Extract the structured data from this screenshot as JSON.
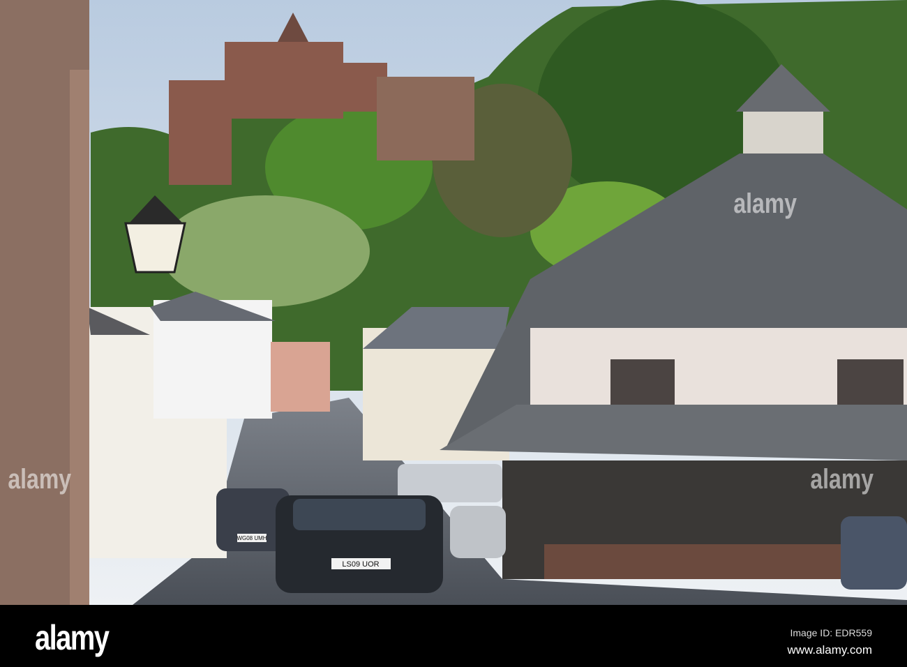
{
  "photo": {
    "subject": "village-street-with-castle-and-yarn-market"
  },
  "watermark": {
    "text": "alamy"
  },
  "footer": {
    "logo": "alamy",
    "image_id": "Image ID: EDR559",
    "url": "www.alamy.com"
  },
  "plates": {
    "front_car": "LS09 UOR",
    "second_car": "WG08 UMH"
  }
}
